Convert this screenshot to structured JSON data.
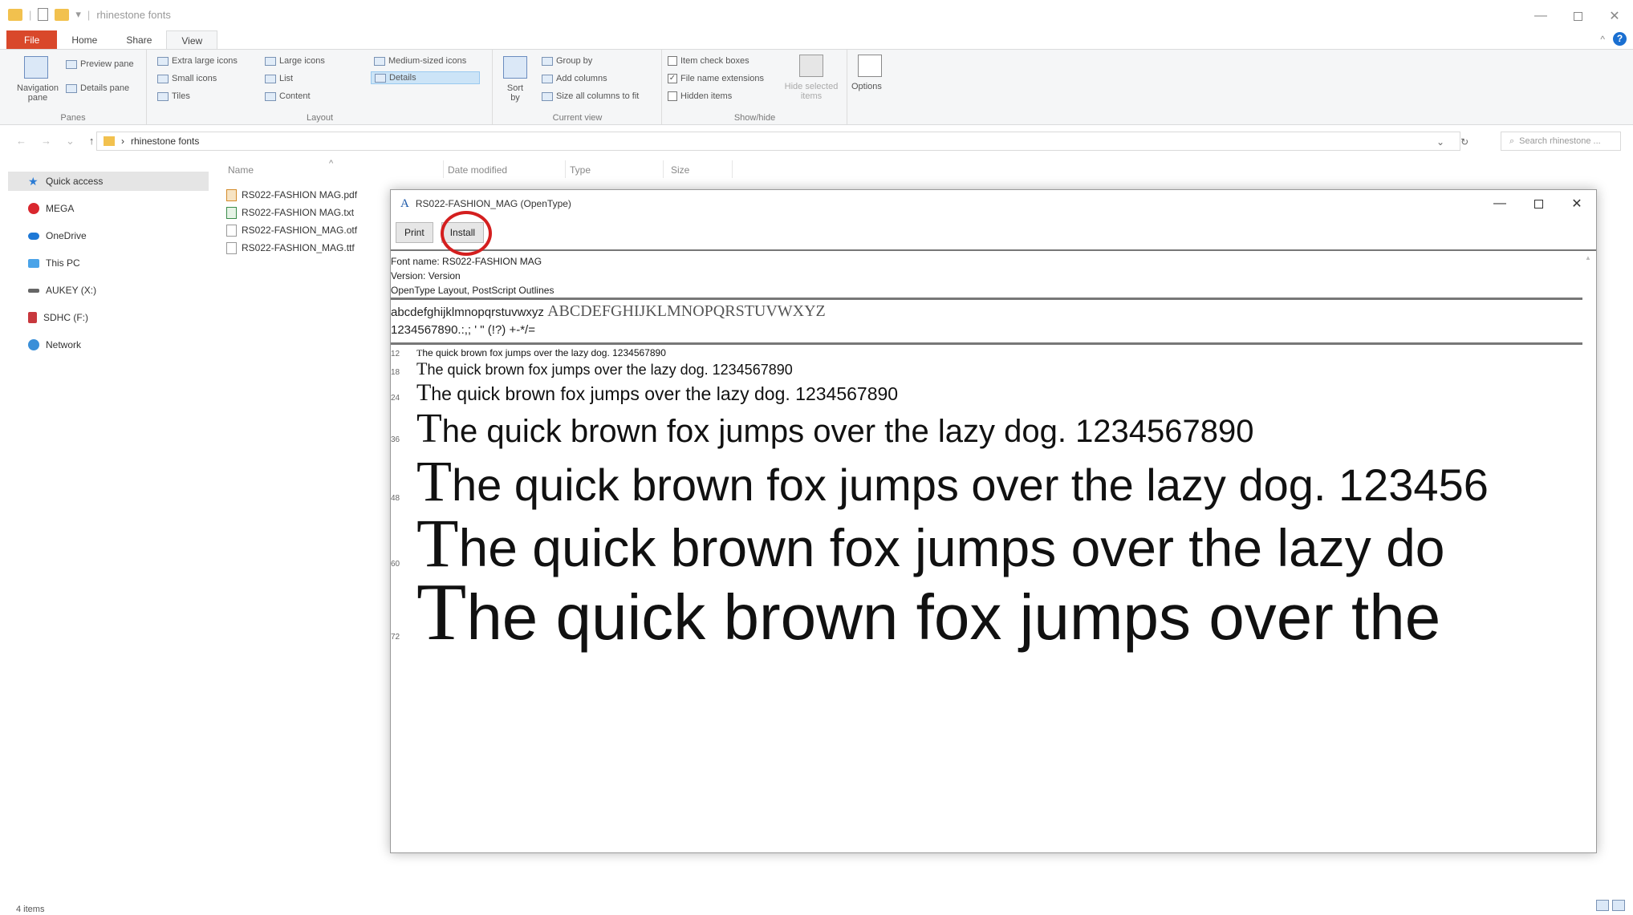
{
  "window": {
    "title": "rhinestone fonts"
  },
  "tabs": [
    "File",
    "Home",
    "Share",
    "View"
  ],
  "ribbon": {
    "panes": {
      "label": "Panes",
      "nav_pane": "Navigation pane",
      "preview_pane": "Preview pane",
      "details_pane": "Details pane"
    },
    "layout": {
      "label": "Layout",
      "items": [
        "Extra large icons",
        "Large icons",
        "Medium-sized icons",
        "Small icons",
        "List",
        "Details",
        "Tiles",
        "Content"
      ]
    },
    "current_view": {
      "label": "Current view",
      "sort_by": "Sort by",
      "group_by": "Group by",
      "add_columns": "Add columns",
      "size_columns": "Size all columns to fit"
    },
    "show_hide": {
      "label": "Show/hide",
      "item_check_boxes": "Item check boxes",
      "file_name_extensions": "File name extensions",
      "hidden_items": "Hidden items",
      "hide_selected": "Hide selected items"
    },
    "options": "Options"
  },
  "address": {
    "path": "rhinestone fonts",
    "search_placeholder": "Search rhinestone ..."
  },
  "nav": [
    "Quick access",
    "MEGA",
    "OneDrive",
    "This PC",
    "AUKEY (X:)",
    "SDHC (F:)",
    "Network"
  ],
  "columns": [
    "Name",
    "Date modified",
    "Type",
    "Size"
  ],
  "files": [
    "RS022-FASHION MAG.pdf",
    "RS022-FASHION MAG.txt",
    "RS022-FASHION_MAG.otf",
    "RS022-FASHION_MAG.ttf"
  ],
  "font_window": {
    "title": "RS022-FASHION_MAG (OpenType)",
    "print": "Print",
    "install": "Install",
    "font_name": "Font name: RS022-FASHION MAG",
    "version": "Version: Version",
    "outline": "OpenType Layout, PostScript Outlines",
    "lowercase": "abcdefghijklmnopqrstuvwxyz",
    "uppercase": "ABCDEFGHIJKLMNOPQRSTUVWXYZ",
    "digits": "1234567890.:,; ' \" (!?) +-*/=",
    "samples": [
      {
        "size": "12",
        "cap": "T",
        "text": "he quick brown fox jumps over the lazy dog. 1234567890"
      },
      {
        "size": "18",
        "cap": "T",
        "text": "he quick brown fox jumps over the lazy dog. 1234567890"
      },
      {
        "size": "24",
        "cap": "T",
        "text": "he quick brown fox jumps over the lazy dog. 1234567890"
      },
      {
        "size": "36",
        "cap": "T",
        "text": "he quick brown fox jumps over the lazy dog. 1234567890"
      },
      {
        "size": "48",
        "cap": "T",
        "text": "he quick brown fox jumps over the lazy dog. 123456"
      },
      {
        "size": "60",
        "cap": "T",
        "text": "he quick brown fox jumps over the lazy do"
      },
      {
        "size": "72",
        "cap": "T",
        "text": "he quick brown fox jumps over the"
      }
    ]
  },
  "status": {
    "items": "4 items"
  },
  "colors": {
    "file_tab": "#d9482b",
    "highlight": "#d41f1f"
  }
}
